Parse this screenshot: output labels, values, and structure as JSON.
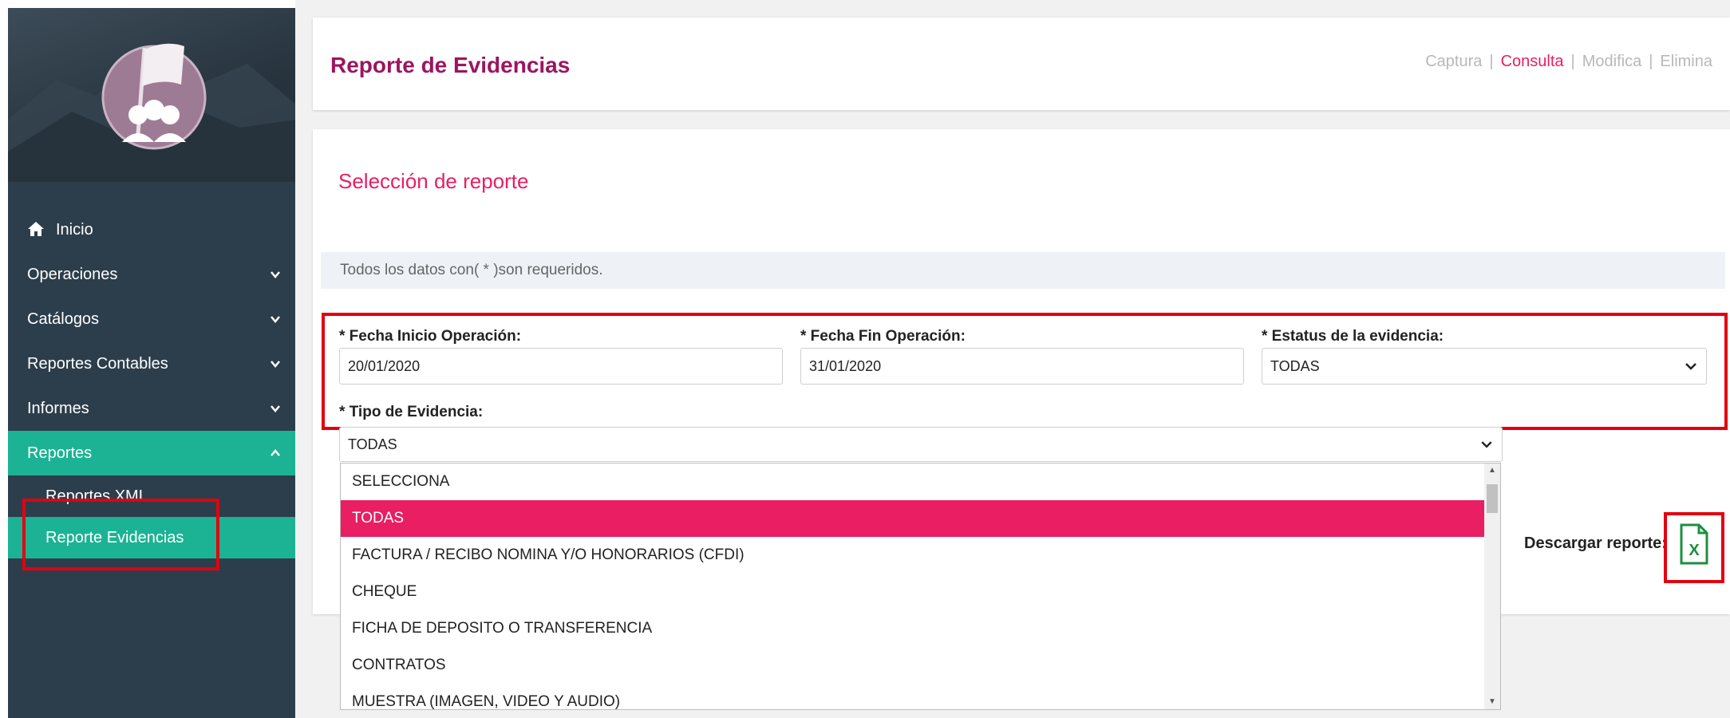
{
  "sidebar": {
    "logo_icon": "users-flag-logo",
    "nav": [
      {
        "label": "Inicio",
        "icon": "home-icon"
      },
      {
        "label": "Operaciones",
        "icon": "chevron-down-icon"
      },
      {
        "label": "Catálogos",
        "icon": "chevron-down-icon"
      },
      {
        "label": "Reportes Contables",
        "icon": "chevron-down-icon"
      },
      {
        "label": "Informes",
        "icon": "chevron-down-icon"
      },
      {
        "label": "Reportes",
        "icon": "chevron-up-icon"
      }
    ],
    "subnav": [
      {
        "label": "Reportes XML"
      },
      {
        "label": "Reporte Evidencias"
      }
    ],
    "active_color": "#1bb394"
  },
  "header": {
    "title": "Reporte de Evidencias",
    "crumbs": [
      "Captura",
      "Consulta",
      "Modifica",
      "Elimina"
    ],
    "active_crumb": "Consulta"
  },
  "form": {
    "section_title": "Selección de reporte",
    "required_note": "Todos los datos con( * )son requeridos.",
    "fecha_inicio": {
      "label": "* Fecha Inicio Operación:",
      "value": "20/01/2020"
    },
    "fecha_fin": {
      "label": "* Fecha Fin Operación:",
      "value": "31/01/2020"
    },
    "estatus": {
      "label": "* Estatus de la evidencia:",
      "value": "TODAS"
    },
    "tipo": {
      "label": "* Tipo de Evidencia:",
      "value": "TODAS"
    },
    "tipo_options": [
      "SELECCIONA",
      "TODAS",
      "FACTURA / RECIBO NOMINA Y/O HONORARIOS (CFDI)",
      "CHEQUE",
      "FICHA DE DEPOSITO O TRANSFERENCIA",
      "CONTRATOS",
      "MUESTRA (IMAGEN, VIDEO Y AUDIO)"
    ],
    "selected_option": "TODAS"
  },
  "download": {
    "label": "Descargar reporte:",
    "icon": "excel-file-icon",
    "icon_text": "X"
  },
  "colors": {
    "accent": "#e91e63",
    "title": "#9c1560",
    "sidebar": "#2c3e4c",
    "highlight": "#e3000f"
  }
}
